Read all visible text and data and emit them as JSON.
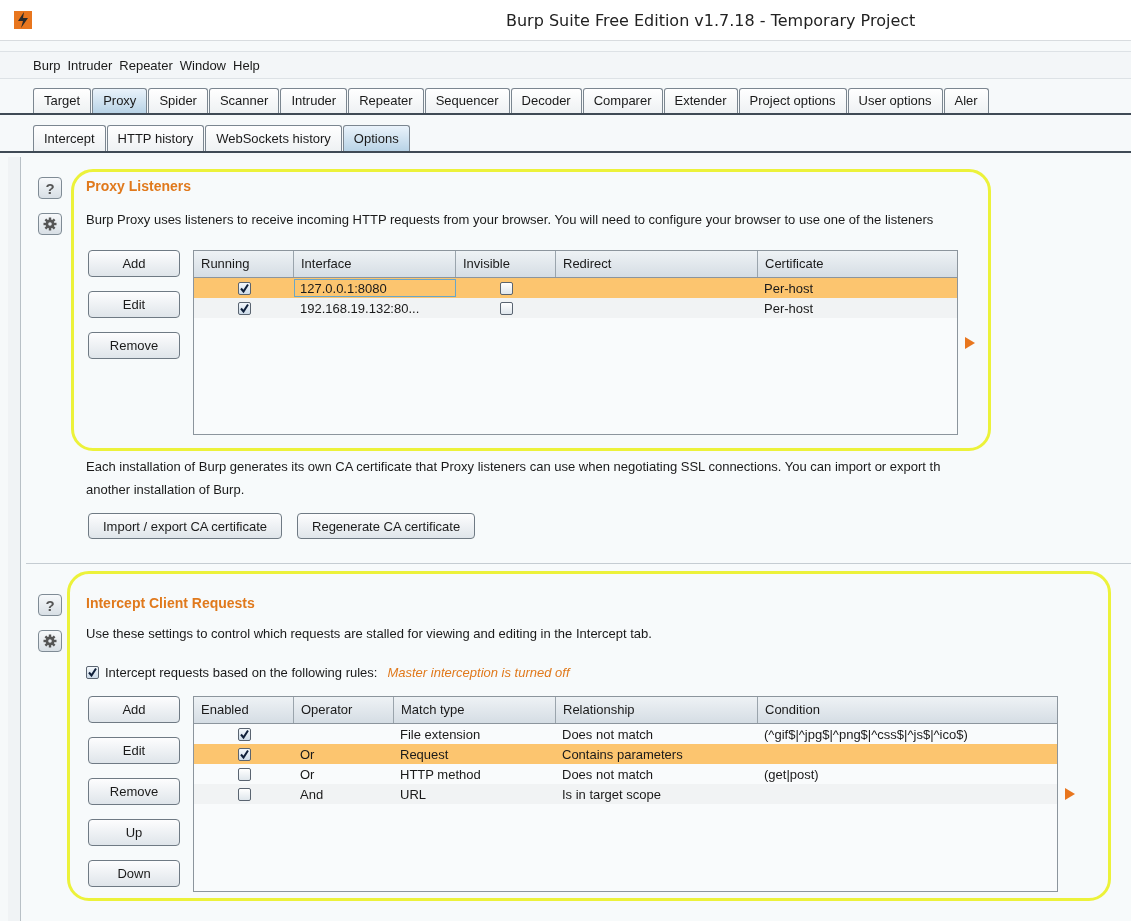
{
  "window": {
    "title": "Burp Suite Free Edition v1.7.18 - Temporary Project"
  },
  "menu": [
    "Burp",
    "Intruder",
    "Repeater",
    "Window",
    "Help"
  ],
  "tabs": [
    {
      "label": "Target",
      "selected": false
    },
    {
      "label": "Proxy",
      "selected": true
    },
    {
      "label": "Spider",
      "selected": false
    },
    {
      "label": "Scanner",
      "selected": false
    },
    {
      "label": "Intruder",
      "selected": false
    },
    {
      "label": "Repeater",
      "selected": false
    },
    {
      "label": "Sequencer",
      "selected": false
    },
    {
      "label": "Decoder",
      "selected": false
    },
    {
      "label": "Comparer",
      "selected": false
    },
    {
      "label": "Extender",
      "selected": false
    },
    {
      "label": "Project options",
      "selected": false
    },
    {
      "label": "User options",
      "selected": false
    },
    {
      "label": "Aler",
      "selected": false
    }
  ],
  "subtabs": [
    {
      "label": "Intercept",
      "selected": false
    },
    {
      "label": "HTTP history",
      "selected": false
    },
    {
      "label": "WebSockets history",
      "selected": false
    },
    {
      "label": "Options",
      "selected": true
    }
  ],
  "sections": [
    {
      "kind": "listeners",
      "help": "?",
      "heading": "Proxy Listeners",
      "description": "Burp Proxy uses listeners to receive incoming HTTP requests from your browser. You will need to configure your browser to use one of the listeners",
      "buttons": [
        "Add",
        "Edit",
        "Remove"
      ],
      "table": {
        "columns": [
          "Running",
          "Interface",
          "Invisible",
          "Redirect",
          "Certificate"
        ],
        "rows": [
          {
            "selected": true,
            "cells": [
              {
                "kind": "check",
                "checked": true
              },
              {
                "kind": "text",
                "text": "127.0.0.1:8080",
                "focused": true
              },
              {
                "kind": "check",
                "checked": false
              },
              {
                "kind": "empty"
              },
              {
                "kind": "text",
                "text": "Per-host"
              }
            ]
          },
          {
            "selected": false,
            "cells": [
              {
                "kind": "check",
                "checked": true
              },
              {
                "kind": "text",
                "text": "192.168.19.132:80..."
              },
              {
                "kind": "check",
                "checked": false
              },
              {
                "kind": "empty"
              },
              {
                "kind": "text",
                "text": "Per-host"
              }
            ]
          }
        ]
      },
      "note": "Each installation of Burp generates its own CA certificate that Proxy listeners can use when negotiating SSL connections. You can import or export th\nanother installation of Burp.",
      "note_buttons": [
        "Import / export CA certificate",
        "Regenerate CA certificate"
      ]
    },
    {
      "kind": "rules",
      "help": "?",
      "heading": "Intercept Client Requests",
      "description": "Use these settings to control which requests are stalled for viewing and editing in the Intercept tab.",
      "option": {
        "checked": true,
        "label": "Intercept requests based on the following rules:",
        "note": "Master interception is turned off"
      },
      "buttons": [
        "Add",
        "Edit",
        "Remove",
        "Up",
        "Down"
      ],
      "table": {
        "columns": [
          "Enabled",
          "Operator",
          "Match type",
          "Relationship",
          "Condition"
        ],
        "rows": [
          {
            "selected": false,
            "cells": [
              {
                "kind": "check",
                "checked": true
              },
              {
                "kind": "empty"
              },
              {
                "kind": "text",
                "text": "File extension"
              },
              {
                "kind": "text",
                "text": "Does not match"
              },
              {
                "kind": "text",
                "text": "(^gif$|^jpg$|^png$|^css$|^js$|^ico$)"
              }
            ]
          },
          {
            "selected": true,
            "cells": [
              {
                "kind": "check",
                "checked": true
              },
              {
                "kind": "text",
                "text": "Or"
              },
              {
                "kind": "text",
                "text": "Request"
              },
              {
                "kind": "text",
                "text": "Contains parameters"
              },
              {
                "kind": "empty"
              }
            ]
          },
          {
            "selected": false,
            "cells": [
              {
                "kind": "check",
                "checked": false
              },
              {
                "kind": "text",
                "text": "Or"
              },
              {
                "kind": "text",
                "text": "HTTP method"
              },
              {
                "kind": "text",
                "text": "Does not match"
              },
              {
                "kind": "text",
                "text": "(get|post)"
              }
            ]
          },
          {
            "selected": false,
            "cells": [
              {
                "kind": "check",
                "checked": false
              },
              {
                "kind": "text",
                "text": "And"
              },
              {
                "kind": "text",
                "text": "URL"
              },
              {
                "kind": "text",
                "text": "Is in target scope"
              },
              {
                "kind": "empty"
              }
            ]
          }
        ]
      }
    }
  ]
}
